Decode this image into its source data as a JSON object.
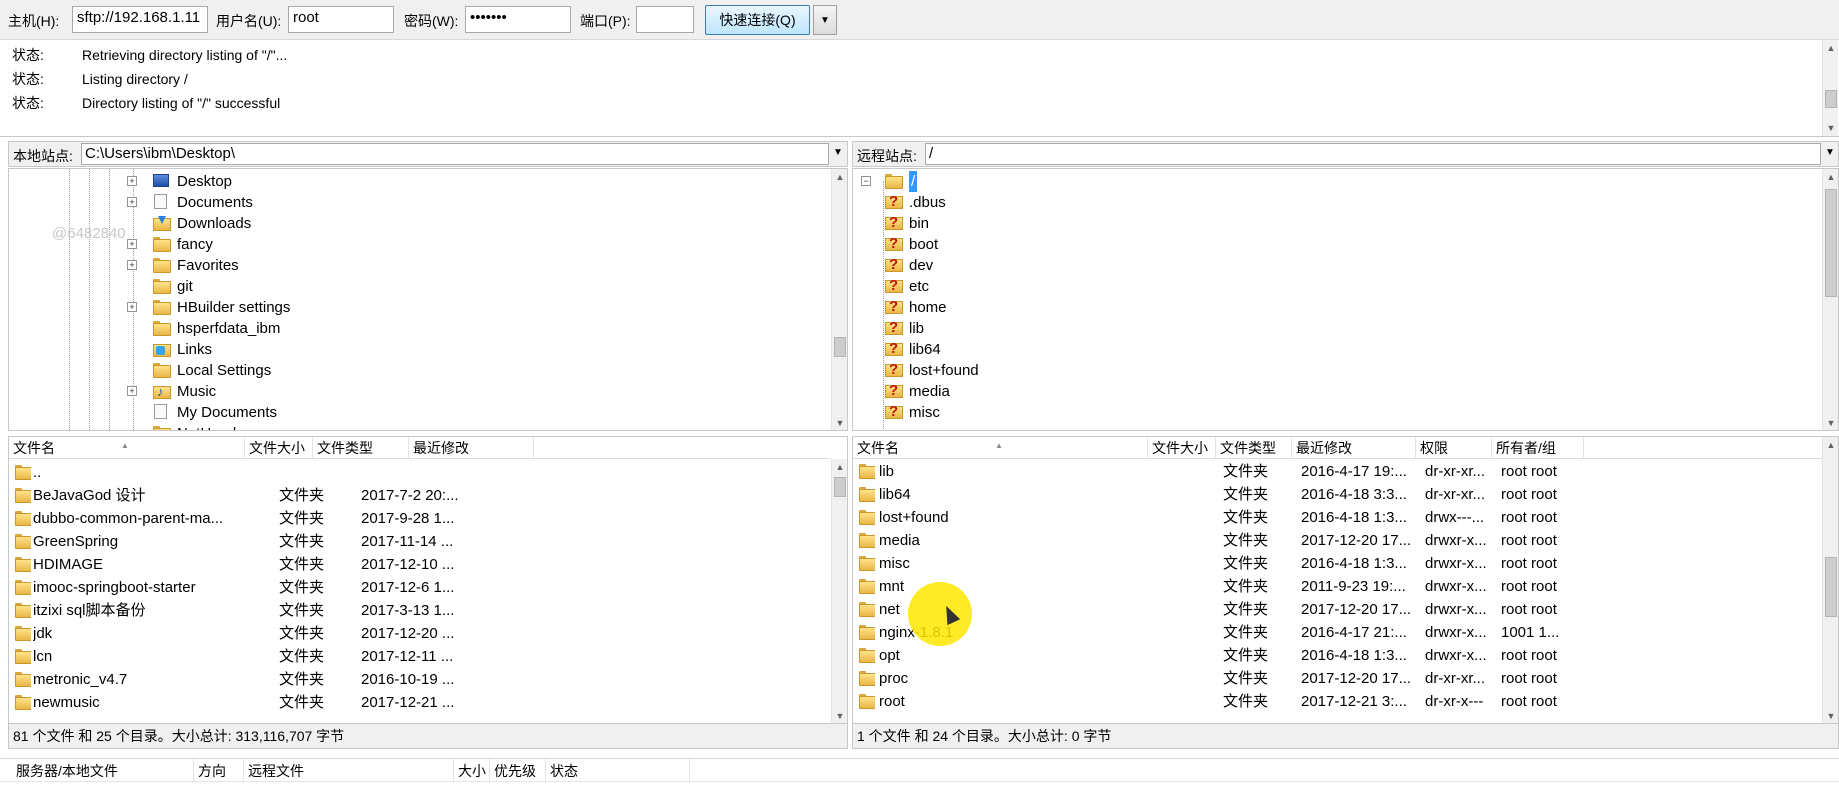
{
  "quickconnect": {
    "host_label": "主机(H):",
    "host_value": "sftp://192.168.1.11",
    "user_label": "用户名(U):",
    "user_value": "root",
    "pass_label": "密码(W):",
    "pass_value": "•••••••",
    "port_label": "端口(P):",
    "port_value": "",
    "connect_label": "快速连接(Q)",
    "dropdown_icon": "chevron-down-icon"
  },
  "log": [
    {
      "label": "状态:",
      "text": "Retrieving directory listing of \"/\"..."
    },
    {
      "label": "状态:",
      "text": "Listing directory /"
    },
    {
      "label": "状态:",
      "text": "Directory listing of \"/\" successful"
    }
  ],
  "local": {
    "site_label": "本地站点:",
    "path": "C:\\Users\\ibm\\Desktop\\",
    "tree": [
      {
        "name": "Desktop",
        "icon": "desktop-icon",
        "expander": "+"
      },
      {
        "name": "Documents",
        "icon": "document-icon",
        "expander": "+"
      },
      {
        "name": "Downloads",
        "icon": "downloads-icon",
        "expander": ""
      },
      {
        "name": "fancy",
        "icon": "folder-icon",
        "expander": "+"
      },
      {
        "name": "Favorites",
        "icon": "folder-icon",
        "expander": "+"
      },
      {
        "name": "git",
        "icon": "folder-icon",
        "expander": ""
      },
      {
        "name": "HBuilder settings",
        "icon": "folder-icon",
        "expander": "+"
      },
      {
        "name": "hsperfdata_ibm",
        "icon": "folder-icon",
        "expander": ""
      },
      {
        "name": "Links",
        "icon": "links-icon",
        "expander": ""
      },
      {
        "name": "Local Settings",
        "icon": "folder-icon",
        "expander": ""
      },
      {
        "name": "Music",
        "icon": "music-icon",
        "expander": "+"
      },
      {
        "name": "My Documents",
        "icon": "document-icon",
        "expander": ""
      },
      {
        "name": "NetHood",
        "icon": "folder-icon",
        "expander": ""
      }
    ],
    "columns": [
      "文件名",
      "文件大小",
      "文件类型",
      "最近修改"
    ],
    "files": [
      {
        "name": "..",
        "size": "",
        "type": "",
        "modified": ""
      },
      {
        "name": "BeJavaGod 设计",
        "size": "",
        "type": "文件夹",
        "modified": "2017-7-2 20:..."
      },
      {
        "name": "dubbo-common-parent-ma...",
        "size": "",
        "type": "文件夹",
        "modified": "2017-9-28 1..."
      },
      {
        "name": "GreenSpring",
        "size": "",
        "type": "文件夹",
        "modified": "2017-11-14 ..."
      },
      {
        "name": "HDIMAGE",
        "size": "",
        "type": "文件夹",
        "modified": "2017-12-10 ..."
      },
      {
        "name": "imooc-springboot-starter",
        "size": "",
        "type": "文件夹",
        "modified": "2017-12-6 1..."
      },
      {
        "name": "itzixi sql脚本备份",
        "size": "",
        "type": "文件夹",
        "modified": "2017-3-13 1..."
      },
      {
        "name": "jdk",
        "size": "",
        "type": "文件夹",
        "modified": "2017-12-20 ..."
      },
      {
        "name": "lcn",
        "size": "",
        "type": "文件夹",
        "modified": "2017-12-11 ..."
      },
      {
        "name": "metronic_v4.7",
        "size": "",
        "type": "文件夹",
        "modified": "2016-10-19 ..."
      },
      {
        "name": "newmusic",
        "size": "",
        "type": "文件夹",
        "modified": "2017-12-21 ..."
      }
    ],
    "status": "81 个文件 和 25 个目录。大小总计: 313,116,707 字节"
  },
  "remote": {
    "site_label": "远程站点:",
    "path": "/",
    "tree_root": "/",
    "tree": [
      ".dbus",
      "bin",
      "boot",
      "dev",
      "etc",
      "home",
      "lib",
      "lib64",
      "lost+found",
      "media",
      "misc"
    ],
    "columns": [
      "文件名",
      "文件大小",
      "文件类型",
      "最近修改",
      "权限",
      "所有者/组"
    ],
    "files": [
      {
        "name": "lib",
        "size": "",
        "type": "文件夹",
        "modified": "2016-4-17 19:...",
        "perm": "dr-xr-xr...",
        "owner": "root root"
      },
      {
        "name": "lib64",
        "size": "",
        "type": "文件夹",
        "modified": "2016-4-18 3:3...",
        "perm": "dr-xr-xr...",
        "owner": "root root"
      },
      {
        "name": "lost+found",
        "size": "",
        "type": "文件夹",
        "modified": "2016-4-18 1:3...",
        "perm": "drwx---...",
        "owner": "root root"
      },
      {
        "name": "media",
        "size": "",
        "type": "文件夹",
        "modified": "2017-12-20 17...",
        "perm": "drwxr-x...",
        "owner": "root root"
      },
      {
        "name": "misc",
        "size": "",
        "type": "文件夹",
        "modified": "2016-4-18 1:3...",
        "perm": "drwxr-x...",
        "owner": "root root"
      },
      {
        "name": "mnt",
        "size": "",
        "type": "文件夹",
        "modified": "2011-9-23 19:...",
        "perm": "drwxr-x...",
        "owner": "root root"
      },
      {
        "name": "net",
        "size": "",
        "type": "文件夹",
        "modified": "2017-12-20 17...",
        "perm": "drwxr-x...",
        "owner": "root root"
      },
      {
        "name": "nginx-1.8.1",
        "size": "",
        "type": "文件夹",
        "modified": "2016-4-17 21:...",
        "perm": "drwxr-x...",
        "owner": "1001 1..."
      },
      {
        "name": "opt",
        "size": "",
        "type": "文件夹",
        "modified": "2016-4-18 1:3...",
        "perm": "drwxr-x...",
        "owner": "root root"
      },
      {
        "name": "proc",
        "size": "",
        "type": "文件夹",
        "modified": "2017-12-20 17...",
        "perm": "dr-xr-xr...",
        "owner": "root root"
      },
      {
        "name": "root",
        "size": "",
        "type": "文件夹",
        "modified": "2017-12-21 3:...",
        "perm": "dr-xr-x---",
        "owner": "root root"
      }
    ],
    "status": "1 个文件 和 24 个目录。大小总计: 0 字节"
  },
  "queue": {
    "columns": [
      "服务器/本地文件",
      "方向",
      "远程文件",
      "大小",
      "优先级",
      "状态"
    ]
  },
  "watermark": "@6482840",
  "colors": {
    "selection": "#3399ff",
    "cursor_highlight": "#ffe600",
    "button_border": "#3c7fb1"
  }
}
